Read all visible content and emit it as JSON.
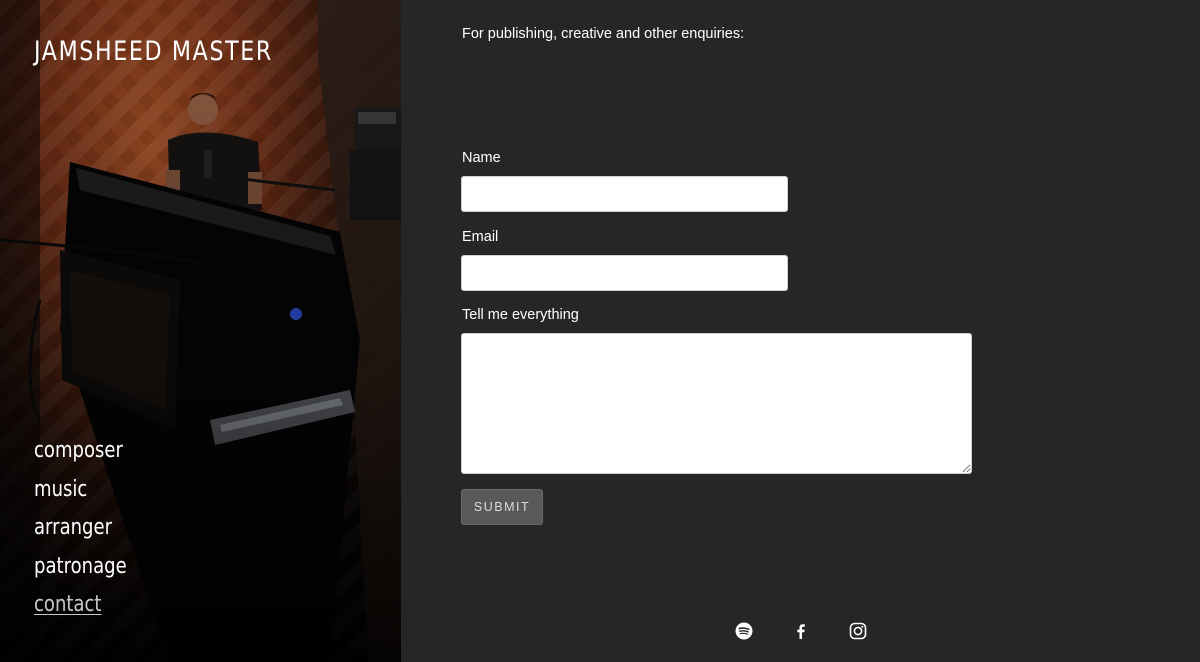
{
  "site": {
    "title": "JAMSHEED MASTER"
  },
  "nav": {
    "items": [
      {
        "label": "composer"
      },
      {
        "label": "music"
      },
      {
        "label": "arranger"
      },
      {
        "label": "patronage"
      },
      {
        "label": "contact",
        "active": true
      }
    ]
  },
  "contact": {
    "intro": "For publishing, creative and other enquiries:",
    "form": {
      "name_label": "Name",
      "name_value": "",
      "email_label": "Email",
      "email_value": "",
      "message_label": "Tell me everything",
      "message_value": "",
      "submit_label": "SUBMIT"
    }
  },
  "social": {
    "icons": [
      "spotify-icon",
      "facebook-icon",
      "instagram-icon"
    ]
  },
  "colors": {
    "background": "#262626",
    "text": "#ffffff",
    "button": "#595959",
    "active_nav": "#c8c8c8"
  }
}
